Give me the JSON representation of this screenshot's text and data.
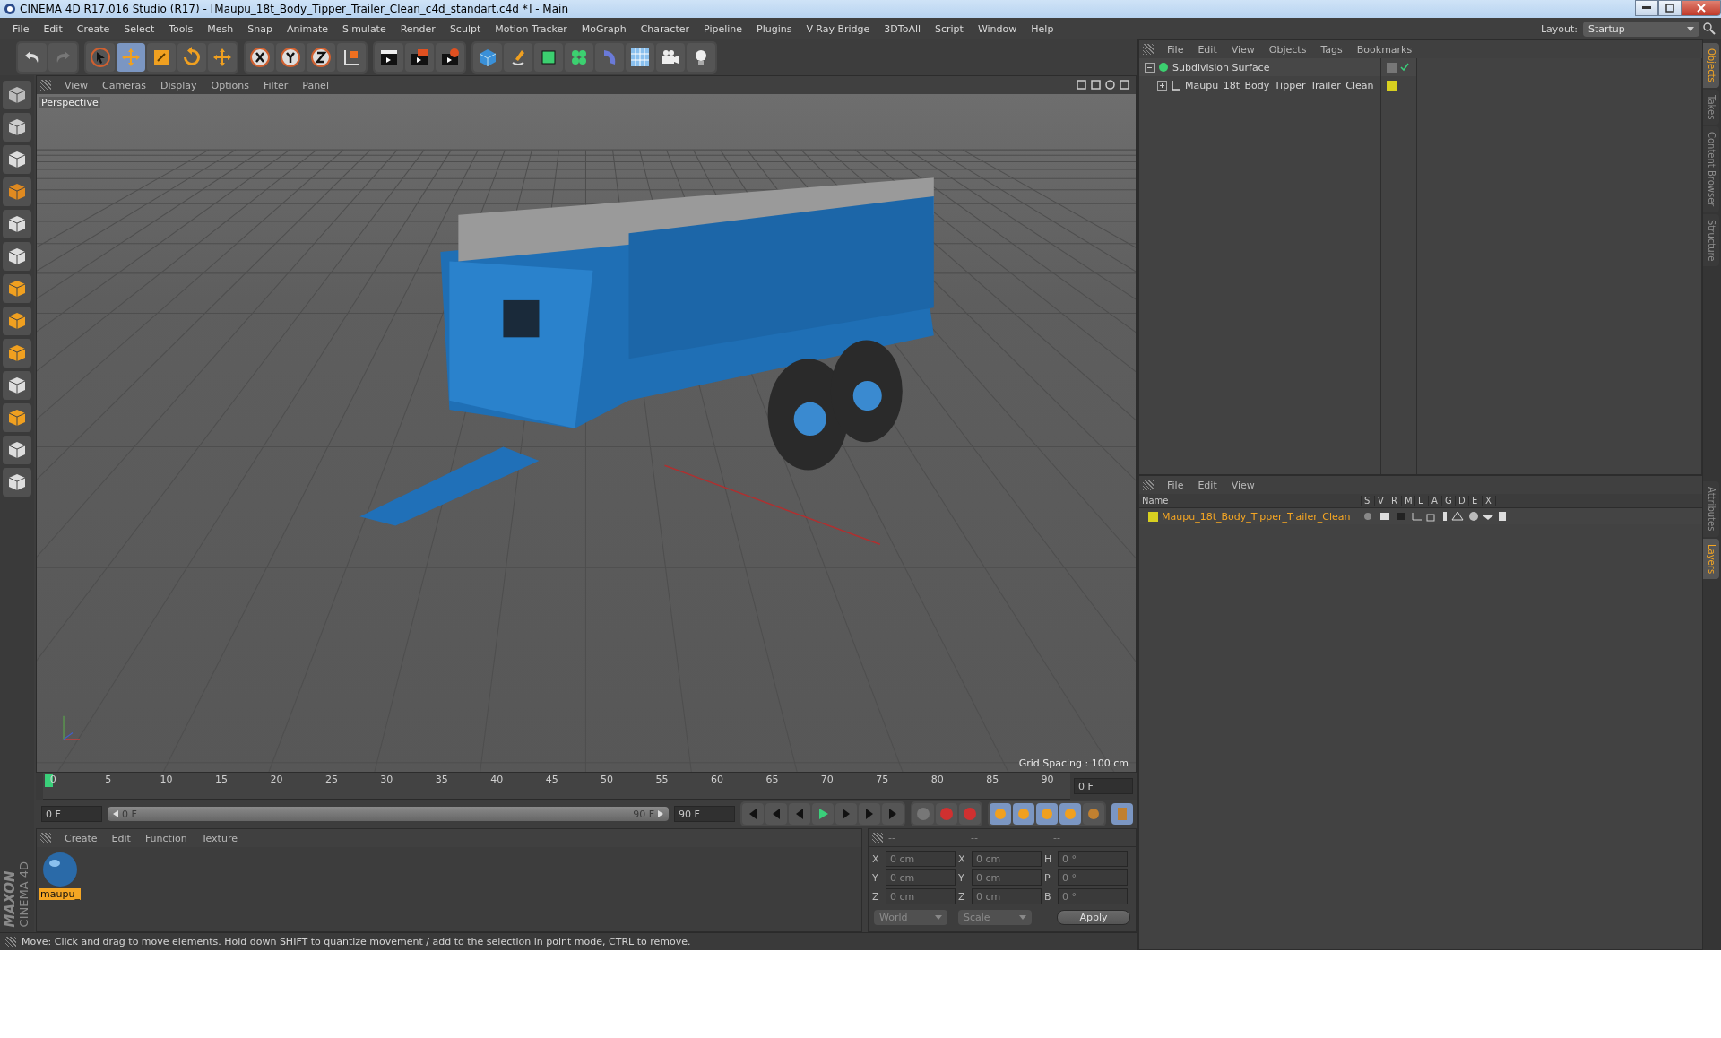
{
  "window": {
    "title": "CINEMA 4D R17.016 Studio (R17) - [Maupu_18t_Body_Tipper_Trailer_Clean_c4d_standart.c4d *] - Main"
  },
  "menu": [
    "File",
    "Edit",
    "Create",
    "Select",
    "Tools",
    "Mesh",
    "Snap",
    "Animate",
    "Simulate",
    "Render",
    "Sculpt",
    "Motion Tracker",
    "MoGraph",
    "Character",
    "Pipeline",
    "Plugins",
    "V-Ray Bridge",
    "3DToAll",
    "Script",
    "Window",
    "Help"
  ],
  "layout": {
    "label": "Layout:",
    "value": "Startup"
  },
  "viewport": {
    "menu": [
      "View",
      "Cameras",
      "Display",
      "Options",
      "Filter",
      "Panel"
    ],
    "camera": "Perspective",
    "grid_spacing": "Grid Spacing : 100 cm"
  },
  "timeline": {
    "ticks": [
      "0",
      "5",
      "10",
      "15",
      "20",
      "25",
      "30",
      "35",
      "40",
      "45",
      "50",
      "55",
      "60",
      "65",
      "70",
      "75",
      "80",
      "85",
      "90"
    ],
    "current": "0 F",
    "start": "0 F",
    "range": {
      "start": "0 F",
      "end": "90 F",
      "level": 1
    },
    "end": "90 F"
  },
  "materials": {
    "menu": [
      "Create",
      "Edit",
      "Function",
      "Texture"
    ],
    "items": [
      {
        "name": "maupu_",
        "selected": true
      }
    ]
  },
  "coordinates": {
    "headers": [
      "--",
      "--",
      "--"
    ],
    "rows": [
      {
        "pos_axis": "X",
        "pos": "0 cm",
        "size_axis": "X",
        "size": "0 cm",
        "rot_axis": "H",
        "rot": "0 °"
      },
      {
        "pos_axis": "Y",
        "pos": "0 cm",
        "size_axis": "Y",
        "size": "0 cm",
        "rot_axis": "P",
        "rot": "0 °"
      },
      {
        "pos_axis": "Z",
        "pos": "0 cm",
        "size_axis": "Z",
        "size": "0 cm",
        "rot_axis": "B",
        "rot": "0 °"
      }
    ],
    "mode": "World",
    "size_mode": "Scale",
    "apply": "Apply"
  },
  "status": "Move: Click and drag to move elements. Hold down SHIFT to quantize movement / add to the selection in point mode, CTRL to remove.",
  "objects": {
    "menu": [
      "File",
      "Edit",
      "View",
      "Objects",
      "Tags",
      "Bookmarks"
    ],
    "tree": [
      {
        "name": "Subdivision Surface",
        "expanded": true,
        "enabled": true,
        "children": [
          {
            "name": "Maupu_18t_Body_Tipper_Trailer_Clean",
            "expanded": false,
            "color": "#d8d020"
          }
        ]
      }
    ]
  },
  "layers": {
    "menu": [
      "File",
      "Edit",
      "View"
    ],
    "columns": [
      "Name",
      "S",
      "V",
      "R",
      "M",
      "L",
      "A",
      "G",
      "D",
      "E",
      "X"
    ],
    "rows": [
      {
        "name": "Maupu_18t_Body_Tipper_Trailer_Clean",
        "color": "#d8d020",
        "selected": true
      }
    ]
  },
  "side_tabs_top": [
    {
      "label": "Objects",
      "selected": true
    },
    {
      "label": "Takes",
      "selected": false
    },
    {
      "label": "Content Browser",
      "selected": false
    },
    {
      "label": "Structure",
      "selected": false
    }
  ],
  "side_tabs_bottom": [
    {
      "label": "Attributes",
      "selected": false
    },
    {
      "label": "Layers",
      "selected": true
    }
  ],
  "logo": {
    "brand": "MAXON",
    "product": "CINEMA 4D"
  }
}
